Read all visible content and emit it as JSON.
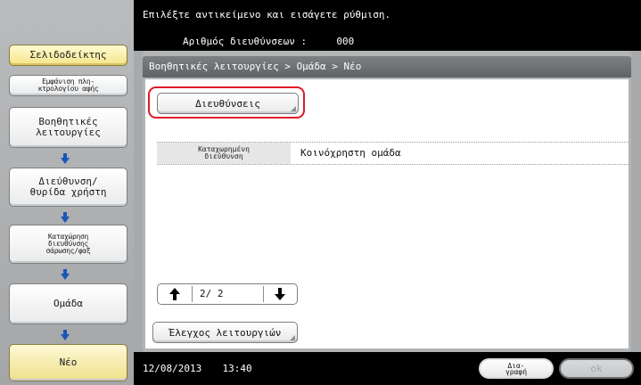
{
  "header": {
    "message": "Επιλέξτε αντικείμενο και εισάγετε ρύθμιση.",
    "address_count_label": "Αριθμός διευθύνσεων :",
    "address_count_value": "000"
  },
  "left_nav": {
    "bookmark": "Σελιδοδείκτης",
    "keypad": "Εμφάνιση πλη-\nκτρολογίου αφής",
    "utility": "Βοηθητικές\nλειτουργίες",
    "address_box": "Διεύθυνση/\nθυρίδα χρήστη",
    "scan_fax": "Καταχώρηση\nδιευθύνσης\nσάρωσης/φαξ",
    "group": "Ομάδα",
    "new": "Νέο"
  },
  "breadcrumb": "Βοηθητικές λειτουργίες > Ομάδα > Νέο",
  "main": {
    "addresses_button": "Διευθύνσεις",
    "registered_address_label": "Καταχωρημένη\nδιεύθυνση",
    "registered_address_value": "Κοινόχρηστη ομάδα",
    "page_indicator": "2/ 2",
    "check_functions_button": "Έλεγχος λειτουργιών"
  },
  "footer": {
    "date": "12/08/2013",
    "time": "13:40",
    "delete_button": "Δια-\nγραφή",
    "ok_button": "ok"
  },
  "colors": {
    "highlight": "#e0192a",
    "nav_arrow": "#1a56b8",
    "active_nav": "#f5e58a"
  }
}
